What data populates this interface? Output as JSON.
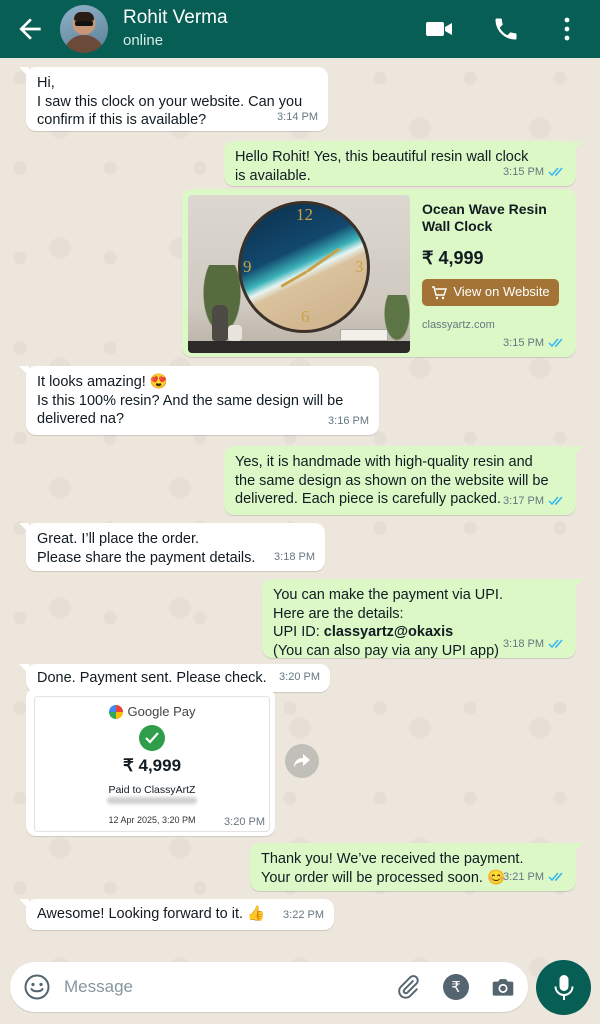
{
  "header": {
    "contact_name": "Rohit Verma",
    "status": "online"
  },
  "messages": [
    {
      "text": "Hi,\nI saw this clock on your website. Can you\nconfirm if this is available?",
      "time": "3:14 PM"
    },
    {
      "text": "Hello Rohit! Yes, this beautiful resin wall clock\nis available.",
      "time": "3:15 PM"
    },
    {
      "title": "Ocean Wave Resin\nWall Clock",
      "price": "₹ 4,999",
      "button": "View on Website",
      "domain": "classyartz.com",
      "time": "3:15 PM"
    },
    {
      "text": "It looks amazing! 😍\nIs this 100% resin? And the same design will be\ndelivered na?",
      "time": "3:16 PM"
    },
    {
      "text": "Yes, it is handmade with high-quality resin and\nthe same design as shown on the website will be\ndelivered. Each piece is carefully packed.",
      "time": "3:17 PM"
    },
    {
      "text": "Great. I’ll place the order.\nPlease share the payment details.",
      "time": "3:18 PM"
    },
    {
      "line1": "You can make the payment via UPI.",
      "line2": "Here are the details:",
      "upi_label": "UPI ID: ",
      "upi_id": "classyartz@okaxis",
      "line4": "(You can also pay via any UPI app)",
      "time": "3:18 PM"
    },
    {
      "text": "Done. Payment sent. Please check.",
      "time": "3:20 PM"
    },
    {
      "brand": "Google Pay",
      "amount": "₹ 4,999",
      "paid_to": "Paid to ClassyArtZ",
      "date": "12 Apr 2025, 3:20 PM",
      "time": "3:20 PM"
    },
    {
      "text": "Thank you! We’ve received the payment.\nYour order will be processed soon. 😊",
      "time": "3:21 PM"
    },
    {
      "text": "Awesome! Looking forward to it. 👍",
      "time": "3:22 PM"
    }
  ],
  "composer": {
    "placeholder": "Message"
  },
  "colors": {
    "header": "#075e54",
    "outgoing": "#dcf8c6",
    "incoming": "#ffffff",
    "read_ticks": "#34b7f1"
  },
  "icons": [
    "back-arrow-icon",
    "video-call-icon",
    "phone-icon",
    "more-icon",
    "emoji-icon",
    "attach-icon",
    "rupee-icon",
    "camera-icon",
    "mic-icon",
    "forward-icon"
  ]
}
